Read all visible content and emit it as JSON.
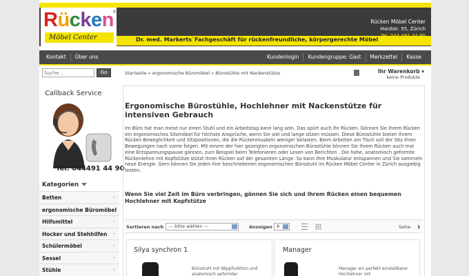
{
  "header": {
    "logo_text": "Rücken",
    "logo_sub": "Möbel Center",
    "tagline": "Dr. med. Markerts`Fachgeschäft für rückenfreundliche, körpergerechte Möbel",
    "store_name": "Rücken Möbel Center",
    "store_address": "Hardstr. 55, Zürich",
    "store_phone": "Tel. 044 491 44 90"
  },
  "nav": {
    "left": [
      "Kontakt",
      "Über uns"
    ],
    "right": [
      "Kundenlogin",
      "Kundengruppe: Gast",
      "Merkzettel",
      "Kasse"
    ]
  },
  "search": {
    "placeholder": "Suche...",
    "button_label": "Go"
  },
  "breadcrumb": "Startseite » ergonomische Büromöbel » Bürostühle mit Nackenstütze",
  "cart": {
    "label": "Ihr Warenkorb",
    "count": "keine Produkte"
  },
  "sidebar": {
    "callback_title": "Callback Service",
    "phone": "Tel. 044491 44 90",
    "categories_title": "Kategorien",
    "categories": [
      "Betten",
      "ergonomische Büromöbel",
      "Hilfsmittel",
      "Hocker und Stehhilfen",
      "Schülermöbel",
      "Sessel",
      "Stühle"
    ]
  },
  "main": {
    "title": "Ergonomische Bürostühle, Hochlehner mit Nackenstütze für intensiven Gebrauch",
    "text": "Im Büro hat man meist nur einen Stuhl und ein Arbeitstag kann lang sein. Das spürt auch Ihr Rücken. Gönnen Sie Ihrem Rücken ein ergonomisches Sitzmöbel für höchste Ansprüche, wenn Sie viel und lange sitzen müssen. Diese Bürostühle bieten Ihrem Rücken Beweglichkeit und Sitzpositionen, die die Rückenmuskeln weniger belasten. Beim Arbeiten am Tisch soll der Sitz Ihren Bewegungen nach vorne folgen. Mit einem der hier gezeigten ergonomischen Bürostühle können Sie Ihrem Rücken auch mal eine Entspannungspause gönnen, zum Beispiel beim Telefonieren oder Lesen von Berichten . Die hohe, anatomisch geformte Rückenlehne mit Kopfstütze stützt ihren Rücken auf der gesamten Länge. So kann Ihre Muskulatur entspannen und Sie sammeln neue Energie. Gern können Sie jeden hier beschriebenen ergonomischen Bürostuhl im Rücken Möbel Center in Zürich ausgiebig testen.",
    "subheading": "Wenn Sie viel Zeit im Büro verbringen, gönnen Sie sich und ihrem Rücken einen bequemen Hochlehner mit Kopfstütze"
  },
  "listing": {
    "sort_label": "Sortieren nach",
    "sort_value": "--- bitte wählen ---",
    "show_label": "Anzeigen",
    "show_value": "8",
    "page_label": "Seite:",
    "page_number": "1"
  },
  "products": [
    {
      "name": "Silya synchron 1",
      "desc": "Bürostuhl mit Wippfunktion und anatomisch geformter"
    },
    {
      "name": "Manager",
      "desc": "Manager ein perfekt einstellbarer Hochlehner mit"
    }
  ]
}
